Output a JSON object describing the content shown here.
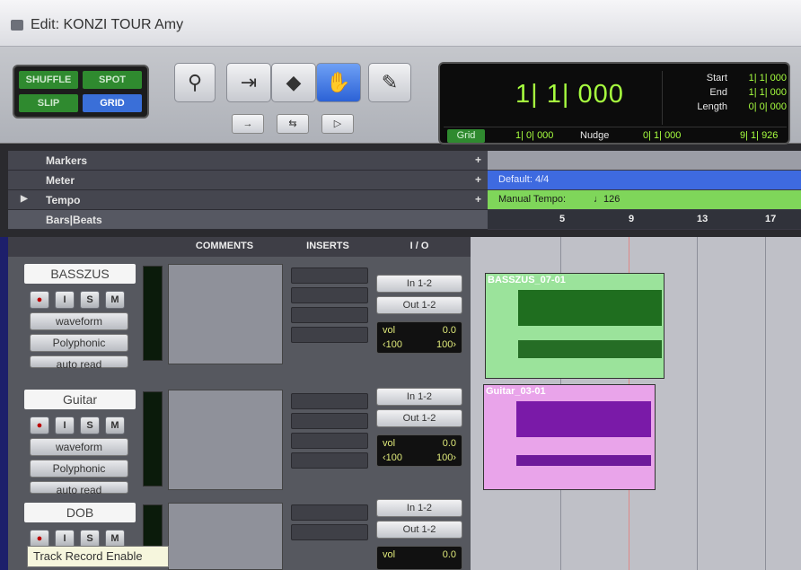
{
  "window": {
    "title": "Edit: KONZI TOUR Amy"
  },
  "modes": [
    "SHUFFLE",
    "SPOT",
    "SLIP",
    "GRID"
  ],
  "counter": {
    "main": "1| 1| 000",
    "start_label": "Start",
    "end_label": "End",
    "length_label": "Length",
    "start": "1| 1| 000",
    "end": "1| 1| 000",
    "length": "0| 0| 000",
    "grid_label": "Grid",
    "grid_value": "1| 0| 000",
    "nudge_label": "Nudge",
    "nudge_value": "0| 1| 000",
    "cursor_value": "9| 1| 926"
  },
  "rulers": {
    "markers": "Markers",
    "meter": "Meter",
    "tempo": "Tempo",
    "bars_beats": "Bars|Beats",
    "meter_value": "Default: 4/4",
    "tempo_value": "Manual Tempo:",
    "tempo_bpm": "♩126",
    "bar_numbers": [
      "5",
      "9",
      "13",
      "17"
    ]
  },
  "mixer": {
    "headers": [
      "COMMENTS",
      "INSERTS",
      "I / O"
    ]
  },
  "tracks": [
    {
      "name": "BASSZUS",
      "mode": "waveform",
      "voice": "Polyphonic",
      "auto": "auto read",
      "in": "In 1-2",
      "out": "Out 1-2",
      "vol_label": "vol",
      "vol": "0.0",
      "pan_l": "‹100",
      "pan_r": "100›",
      "clip": "BASSZUS_07-01"
    },
    {
      "name": "Guitar",
      "mode": "waveform",
      "voice": "Polyphonic",
      "auto": "auto read",
      "in": "In 1-2",
      "out": "Out 1-2",
      "vol_label": "vol",
      "vol": "0.0",
      "pan_l": "‹100",
      "pan_r": "100›",
      "clip": "Guitar_03-01"
    },
    {
      "name": "DOB",
      "in": "In 1-2",
      "out": "Out 1-2",
      "vol_label": "vol",
      "vol": "0.0"
    }
  ],
  "track_buttons": [
    "I",
    "S",
    "M"
  ],
  "tooltip": "Track Record Enable",
  "colors": {
    "counter_text": "#a7ff3f",
    "bass_clip": "#9be39b",
    "guitar_clip": "#e9a4ea",
    "active_tool": "#3a72e0"
  }
}
